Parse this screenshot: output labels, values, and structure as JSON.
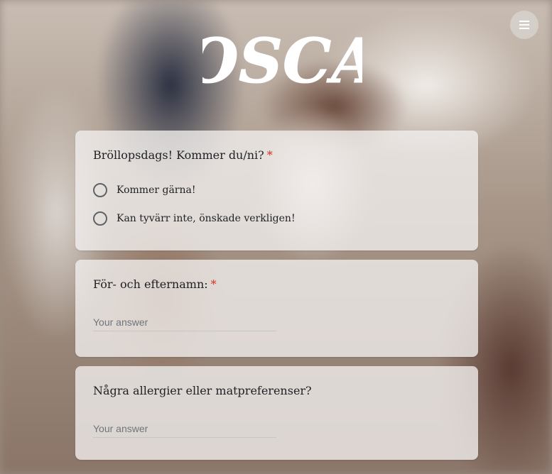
{
  "logo": {
    "text": "OSCA",
    "icon": "osca-script-logo"
  },
  "menu": {
    "icon": "hamburger-menu-icon"
  },
  "questions": [
    {
      "title": "Bröllopsdags! Kommer du/ni?",
      "required_mark": "*",
      "options": [
        "Kommer gärna!",
        "Kan tyvärr inte, önskade verkligen!"
      ]
    },
    {
      "title": "För- och efternamn:",
      "required_mark": "*",
      "placeholder": "Your answer"
    },
    {
      "title": "Några allergier eller matpreferenser?",
      "placeholder": "Your answer"
    }
  ],
  "colors": {
    "required": "#d93025",
    "card": "#f2f0ee",
    "text": "#202124"
  }
}
